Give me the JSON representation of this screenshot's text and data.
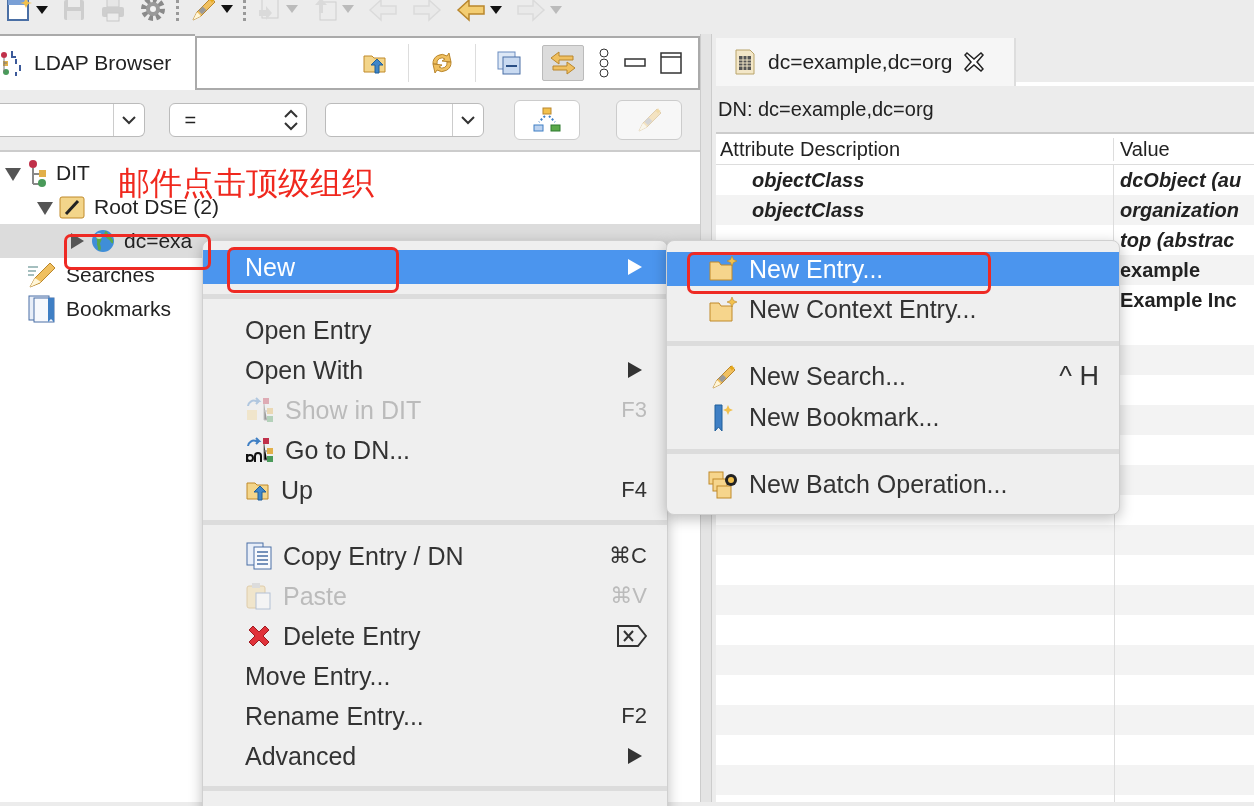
{
  "toolbar": [
    {
      "kind": "new",
      "disabled": false,
      "dropdown": true
    },
    {
      "kind": "save",
      "disabled": true,
      "dropdown": false
    },
    {
      "kind": "print",
      "disabled": true,
      "dropdown": false
    },
    {
      "kind": "gear",
      "disabled": false,
      "dropdown": false
    },
    {
      "kind": "separator"
    },
    {
      "kind": "search",
      "disabled": false,
      "dropdown": true
    },
    {
      "kind": "separator"
    },
    {
      "kind": "import",
      "disabled": true,
      "dropdown": true
    },
    {
      "kind": "export",
      "disabled": true,
      "dropdown": true
    },
    {
      "kind": "nav-back",
      "disabled": true,
      "dropdown": false
    },
    {
      "kind": "nav-forward",
      "disabled": true,
      "dropdown": false
    },
    {
      "kind": "back",
      "disabled": false,
      "dropdown": true
    },
    {
      "kind": "forward",
      "disabled": true,
      "dropdown": true
    }
  ],
  "view": {
    "title": "LDAP Browser",
    "tools": [
      {
        "kind": "up",
        "selected": false
      },
      {
        "kind": "refresh",
        "selected": false
      },
      {
        "kind": "collapse",
        "selected": false
      },
      {
        "kind": "link",
        "selected": true
      }
    ]
  },
  "filter": {
    "operator": "="
  },
  "tree": [
    {
      "label": "DIT",
      "kind": "dit",
      "expanded": true,
      "selected": false,
      "children": [
        {
          "label": "Root DSE (2)",
          "kind": "root",
          "expanded": true,
          "selected": false,
          "children": [
            {
              "label": "dc=exa",
              "kind": "entry",
              "expanded": false,
              "selected": true
            }
          ]
        }
      ]
    },
    {
      "label": "Searches",
      "kind": "searches",
      "selected": false
    },
    {
      "label": "Bookmarks",
      "kind": "bookmarks",
      "selected": false
    }
  ],
  "annotation": {
    "text": "邮件点击顶级组织"
  },
  "editor": {
    "tab": {
      "title": "dc=example,dc=org"
    },
    "dn": "DN: dc=example,dc=org",
    "table": {
      "columns": [
        "Attribute Description",
        "Value"
      ],
      "rows": [
        {
          "attribute": "objectClass",
          "value": "dcObject (au"
        },
        {
          "attribute": "objectClass",
          "value": "organization"
        },
        {
          "value": "top (abstrac"
        },
        {
          "value": "example"
        },
        {
          "value": "Example Inc"
        }
      ]
    }
  },
  "context_menu": {
    "items": [
      {
        "kind": "item",
        "label": "New",
        "selected": true,
        "disabled": false,
        "submenu": true
      },
      {
        "kind": "separator"
      },
      {
        "kind": "item",
        "label": "Open Entry",
        "selected": false,
        "disabled": false,
        "submenu": false
      },
      {
        "kind": "item",
        "label": "Open With",
        "selected": false,
        "disabled": false,
        "submenu": true
      },
      {
        "kind": "item",
        "label": "Show in DIT",
        "selected": false,
        "disabled": true,
        "submenu": false,
        "shortcut": "F3"
      },
      {
        "kind": "item",
        "label": "Go to DN...",
        "selected": false,
        "disabled": false,
        "submenu": false
      },
      {
        "kind": "item",
        "label": "Up",
        "selected": false,
        "disabled": false,
        "submenu": false,
        "shortcut": "F4"
      },
      {
        "kind": "separator"
      },
      {
        "kind": "item",
        "label": "Copy Entry / DN",
        "selected": false,
        "disabled": false,
        "submenu": false,
        "shortcut": "⌘C"
      },
      {
        "kind": "item",
        "label": "Paste",
        "selected": false,
        "disabled": true,
        "submenu": false,
        "shortcut": "⌘V"
      },
      {
        "kind": "item",
        "label": "Delete Entry",
        "selected": false,
        "disabled": false,
        "submenu": false
      },
      {
        "kind": "item",
        "label": "Move Entry...",
        "selected": false,
        "disabled": false,
        "submenu": false
      },
      {
        "kind": "item",
        "label": "Rename Entry...",
        "selected": false,
        "disabled": false,
        "submenu": false,
        "shortcut": "F2"
      },
      {
        "kind": "item",
        "label": "Advanced",
        "selected": false,
        "disabled": false,
        "submenu": true
      },
      {
        "kind": "separator"
      }
    ]
  },
  "submenu": {
    "items": [
      {
        "kind": "item",
        "label": "New Entry...",
        "selected": true
      },
      {
        "kind": "item",
        "label": "New Context Entry...",
        "selected": false
      },
      {
        "kind": "separator"
      },
      {
        "kind": "item",
        "label": "New Search...",
        "selected": false,
        "shortcut": "^ H"
      },
      {
        "kind": "item",
        "label": "New Bookmark...",
        "selected": false
      },
      {
        "kind": "separator"
      },
      {
        "kind": "item",
        "label": "New Batch Operation...",
        "selected": false
      }
    ]
  }
}
